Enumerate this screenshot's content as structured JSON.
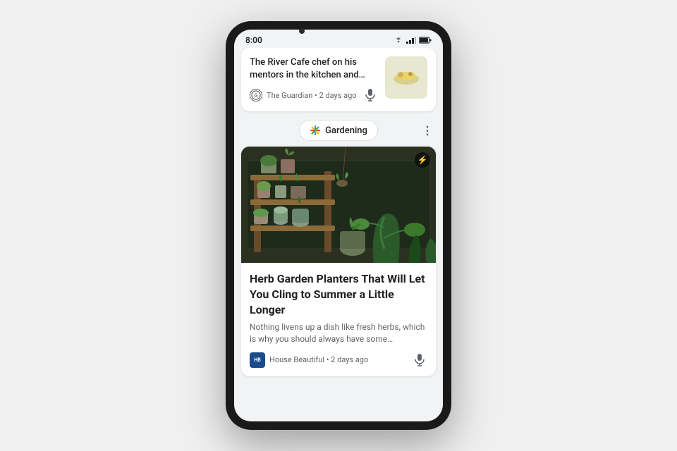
{
  "phone": {
    "status_bar": {
      "time": "8:00",
      "signal": "▲",
      "battery": "🔋"
    }
  },
  "article1": {
    "title": "The River Cafe chef on his mentors in the kitchen and…",
    "source": "The Guardian",
    "time_ago": "2 days ago",
    "source_initials": "G"
  },
  "category": {
    "label": "Gardening",
    "more_label": "⋮"
  },
  "article2": {
    "title": "Herb Garden Planters That Will Let You Cling to Summer a Little Longer",
    "excerpt": "Nothing livens up a dish like fresh herbs, which is why you should always have some…",
    "source": "House Beautiful",
    "source_initials": "HB",
    "time_ago": "2 days ago"
  }
}
